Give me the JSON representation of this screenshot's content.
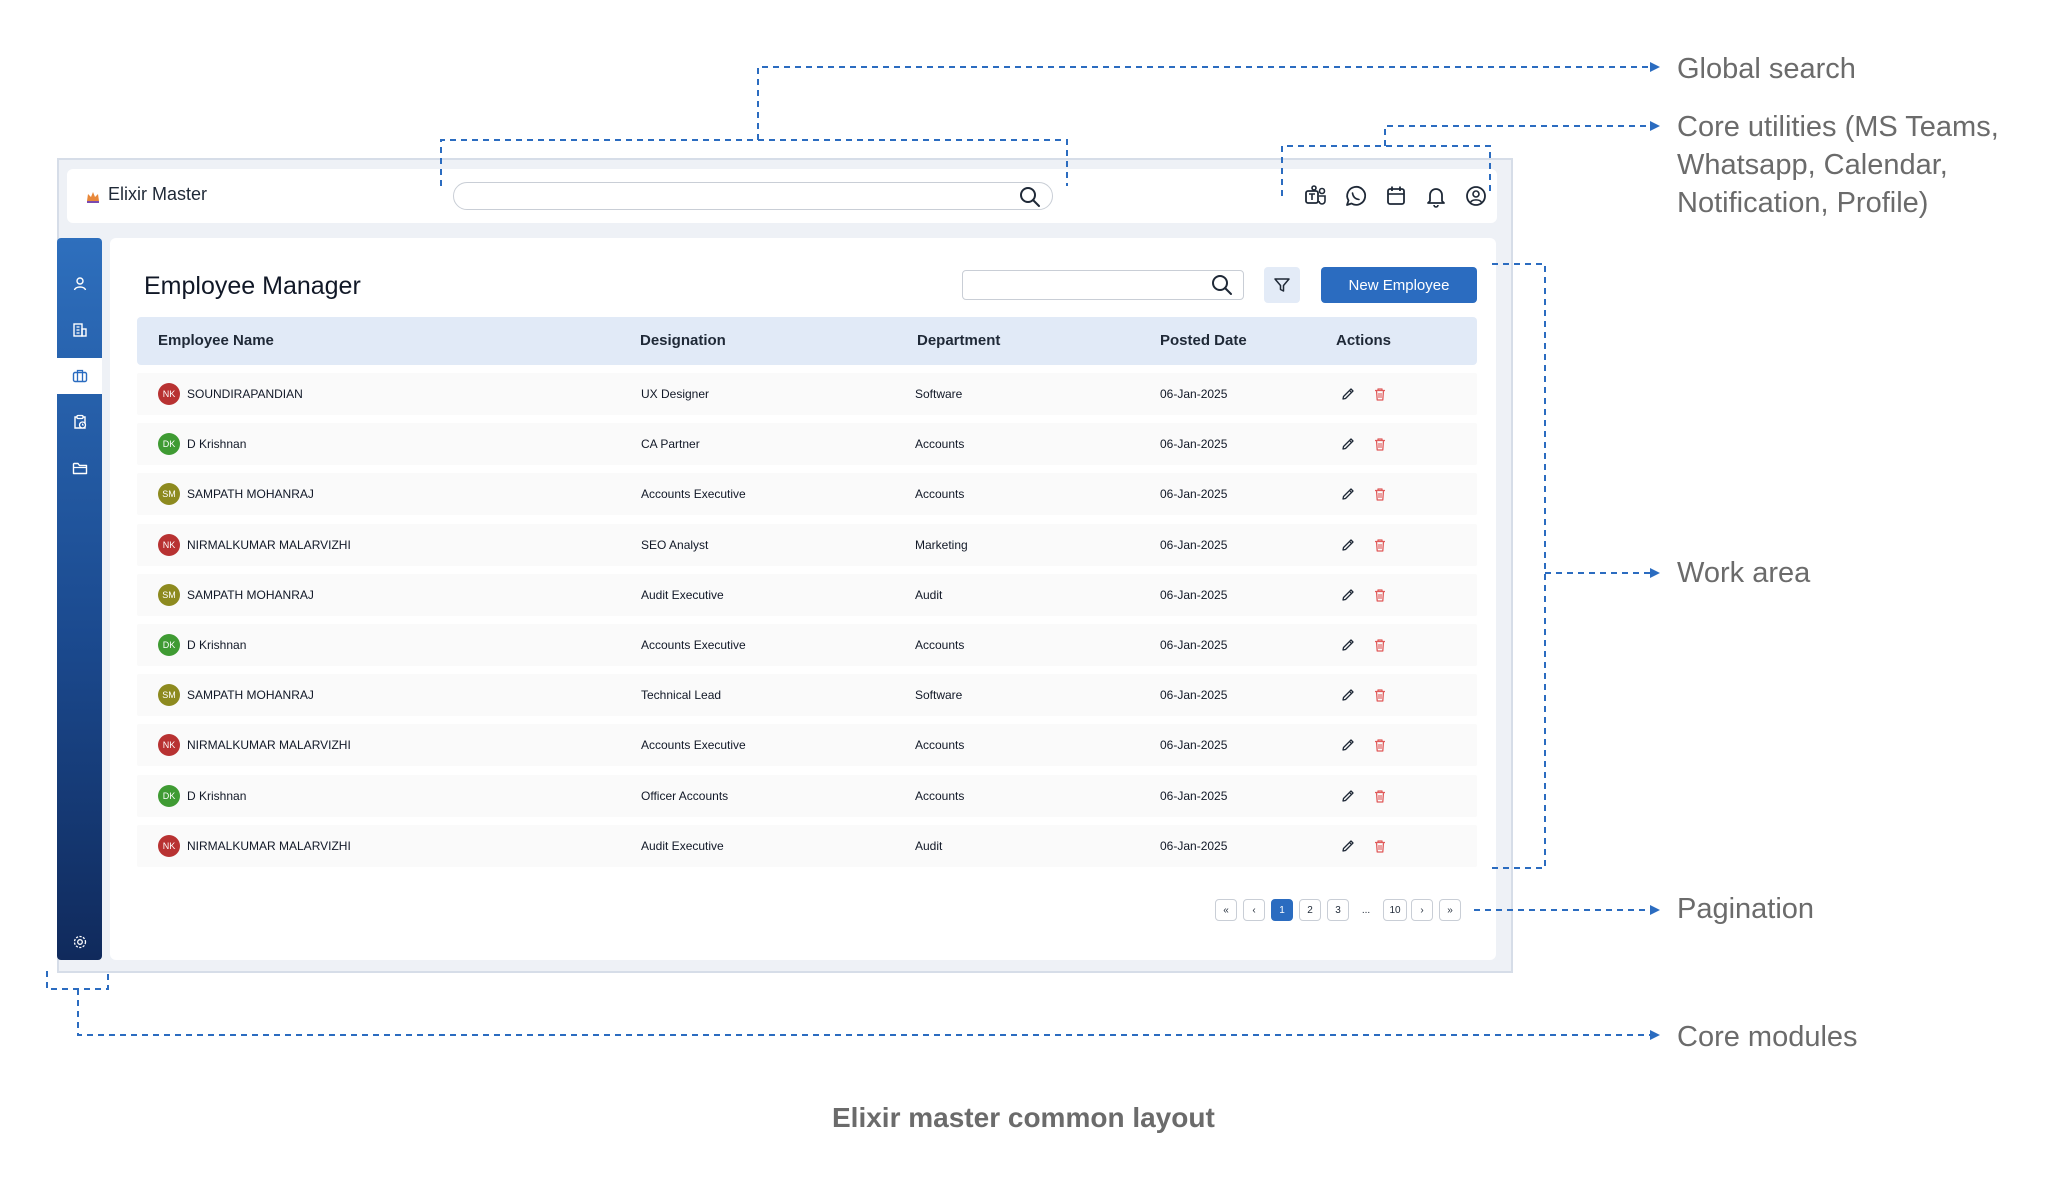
{
  "app": {
    "logo_text": "Elixir Master",
    "logo_icon": "crown-icon"
  },
  "global_search": {
    "placeholder": "",
    "icon": "search-icon"
  },
  "utilities": [
    {
      "name": "ms-teams-icon"
    },
    {
      "name": "whatsapp-icon"
    },
    {
      "name": "calendar-icon"
    },
    {
      "name": "notification-icon"
    },
    {
      "name": "profile-icon"
    }
  ],
  "sidebar": {
    "items": [
      {
        "name": "user-icon"
      },
      {
        "name": "building-icon"
      },
      {
        "name": "briefcase-icon",
        "active": true
      },
      {
        "name": "clock-clipboard-icon"
      },
      {
        "name": "folder-icon"
      }
    ],
    "settings_icon": "gear-icon"
  },
  "work": {
    "title": "Employee Manager",
    "search_placeholder": "",
    "new_button": "New Employee",
    "filter_icon": "filter-icon"
  },
  "table": {
    "headers": [
      "Employee Name",
      "Designation",
      "Department",
      "Posted Date",
      "Actions"
    ],
    "rows": [
      {
        "initials": "NK",
        "color": "#b83232",
        "name": "SOUNDIRAPANDIAN",
        "designation": "UX Designer",
        "department": "Software",
        "date": "06-Jan-2025"
      },
      {
        "initials": "DK",
        "color": "#3f9b33",
        "name": "D Krishnan",
        "designation": "CA Partner",
        "department": "Accounts",
        "date": "06-Jan-2025"
      },
      {
        "initials": "SM",
        "color": "#8d8a1f",
        "name": "SAMPATH MOHANRAJ",
        "designation": "Accounts Executive",
        "department": "Accounts",
        "date": "06-Jan-2025"
      },
      {
        "initials": "NK",
        "color": "#b83232",
        "name": "NIRMALKUMAR MALARVIZHI",
        "designation": "SEO Analyst",
        "department": "Marketing",
        "date": "06-Jan-2025"
      },
      {
        "initials": "SM",
        "color": "#8d8a1f",
        "name": "SAMPATH MOHANRAJ",
        "designation": "Audit Executive",
        "department": "Audit",
        "date": "06-Jan-2025"
      },
      {
        "initials": "DK",
        "color": "#3f9b33",
        "name": "D Krishnan",
        "designation": "Accounts Executive",
        "department": "Accounts",
        "date": "06-Jan-2025"
      },
      {
        "initials": "SM",
        "color": "#8d8a1f",
        "name": "SAMPATH MOHANRAJ",
        "designation": "Technical Lead",
        "department": "Software",
        "date": "06-Jan-2025"
      },
      {
        "initials": "NK",
        "color": "#b83232",
        "name": "NIRMALKUMAR MALARVIZHI",
        "designation": "Accounts Executive",
        "department": "Accounts",
        "date": "06-Jan-2025"
      },
      {
        "initials": "DK",
        "color": "#3f9b33",
        "name": "D Krishnan",
        "designation": "Officer Accounts",
        "department": "Accounts",
        "date": "06-Jan-2025"
      },
      {
        "initials": "NK",
        "color": "#b83232",
        "name": "NIRMALKUMAR MALARVIZHI",
        "designation": "Audit Executive",
        "department": "Audit",
        "date": "06-Jan-2025"
      }
    ],
    "edit_icon": "pencil-icon",
    "delete_icon": "trash-icon"
  },
  "pagination": [
    "«",
    "‹",
    "1",
    "2",
    "3",
    "...",
    "10",
    "›",
    "»"
  ],
  "pagination_active": "1",
  "annotations": {
    "global_search": "Global search",
    "core_utilities": [
      "Core utilities (MS Teams,",
      "Whatsapp, Calendar,",
      "Notification, Profile)"
    ],
    "work_area": "Work area",
    "pagination": "Pagination",
    "core_modules": "Core modules"
  },
  "caption": "Elixir master common layout",
  "colors": {
    "primary": "#2b6cc0",
    "annotation_line": "#2b6cc0",
    "delete": "#e05a5a"
  }
}
